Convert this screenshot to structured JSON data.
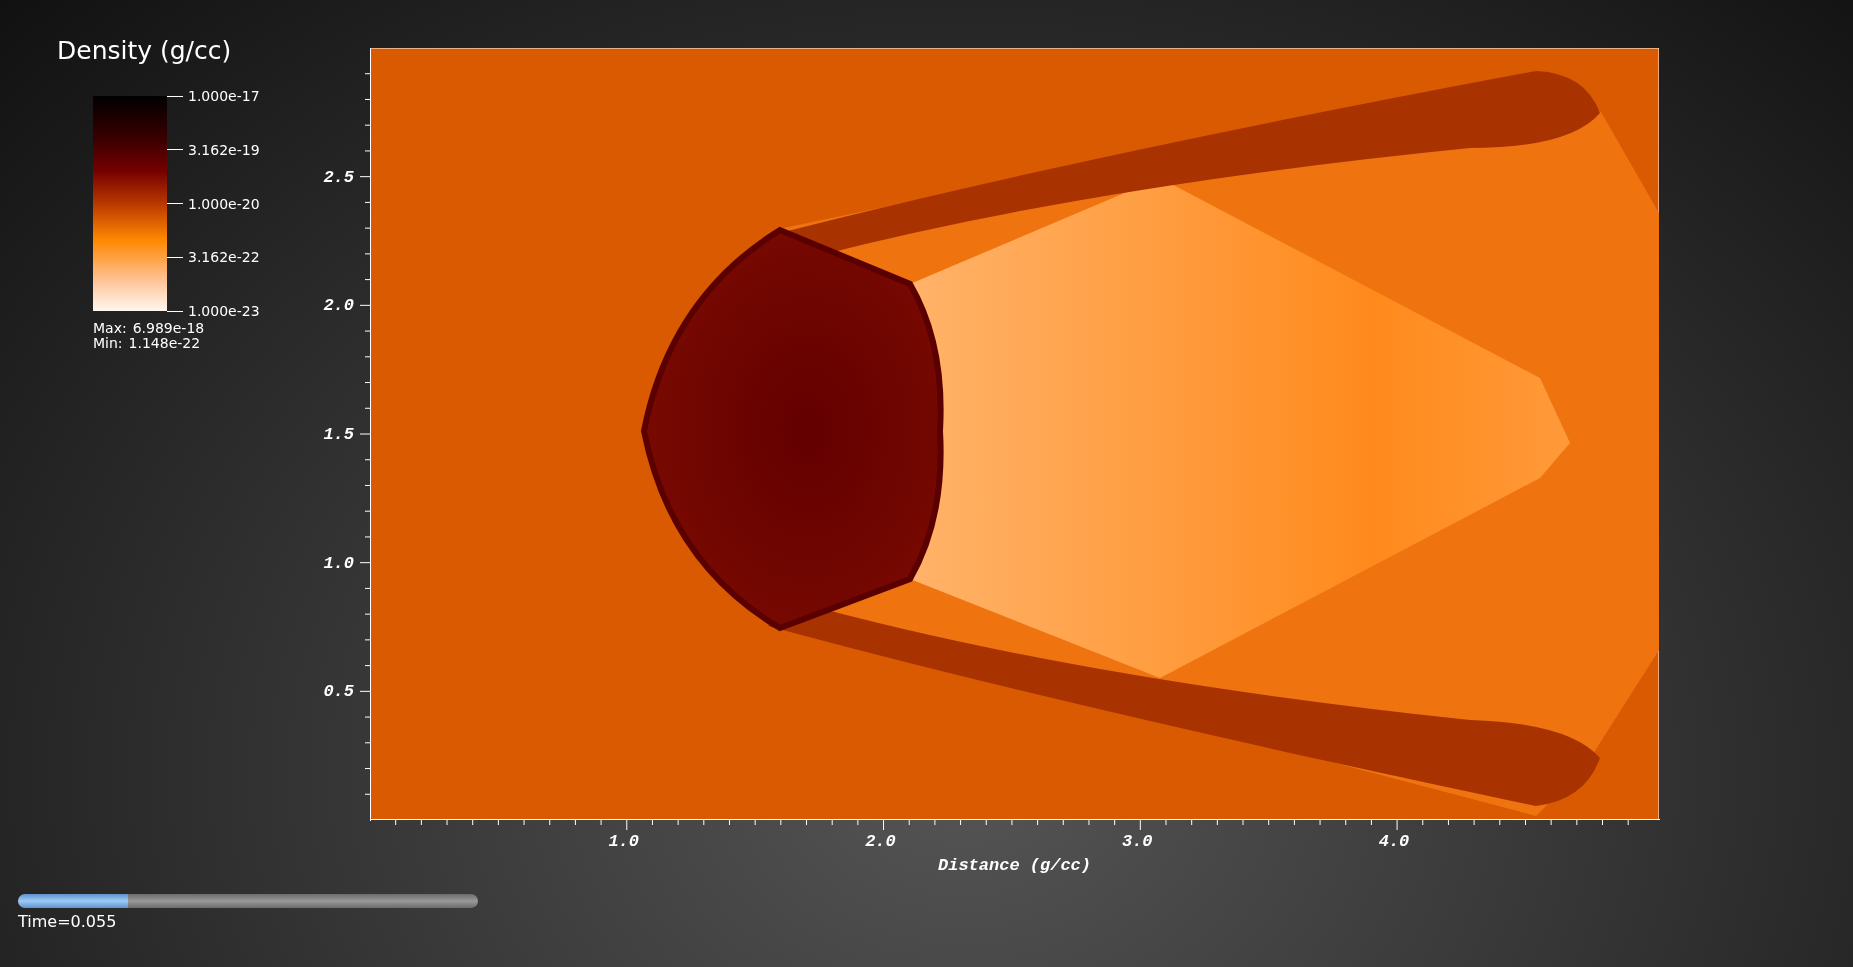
{
  "legend": {
    "title": "Density (g/cc)",
    "tick_labels": [
      "1.000e-17",
      "3.162e-19",
      "1.000e-20",
      "3.162e-22",
      "1.000e-23"
    ],
    "max": {
      "label": "Max:",
      "value": "6.989e-18"
    },
    "min": {
      "label": "Min:",
      "value": "1.148e-22"
    }
  },
  "plot": {
    "y_tick_labels": [
      "2.5",
      "2.0",
      "1.5",
      "1.0",
      "0.5"
    ],
    "x_tick_labels": [
      "1.0",
      "2.0",
      "3.0",
      "4.0"
    ],
    "xlabel": "Distance (g/cc)"
  },
  "time_slider": {
    "level": 0.24,
    "label": "Time=0.055"
  }
}
